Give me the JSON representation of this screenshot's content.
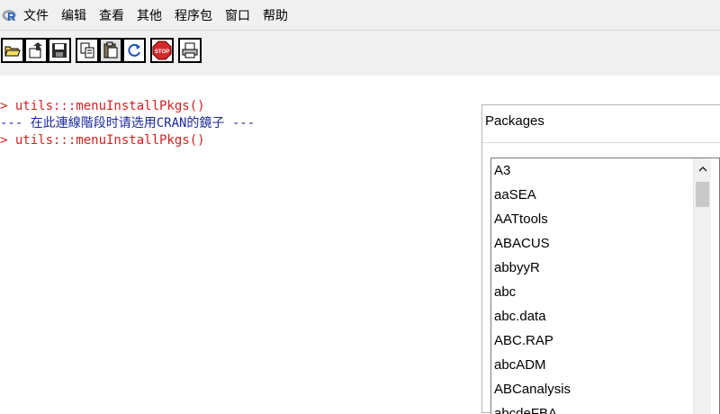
{
  "menu": {
    "items": [
      "文件",
      "编辑",
      "查看",
      "其他",
      "程序包",
      "窗口",
      "帮助"
    ]
  },
  "toolbar": {
    "buttons": [
      "open-script",
      "load-workspace",
      "save",
      "copy",
      "paste",
      "refresh",
      "stop",
      "print"
    ],
    "stop_label": "STOP"
  },
  "console": {
    "line1": "> utils:::menuInstallPkgs()",
    "line2": "--- 在此連線階段时请选用CRAN的鏡子 ---",
    "line3": "> utils:::menuInstallPkgs()"
  },
  "packages_dialog": {
    "title": "Packages",
    "items": [
      "A3",
      "aaSEA",
      "AATtools",
      "ABACUS",
      "abbyyR",
      "abc",
      "abc.data",
      "ABC.RAP",
      "abcADM",
      "ABCanalysis",
      "abcdeFBA"
    ]
  },
  "colors": {
    "prompt": "#d42020",
    "message": "#1a2a9a",
    "chrome": "#f0f0f0"
  }
}
